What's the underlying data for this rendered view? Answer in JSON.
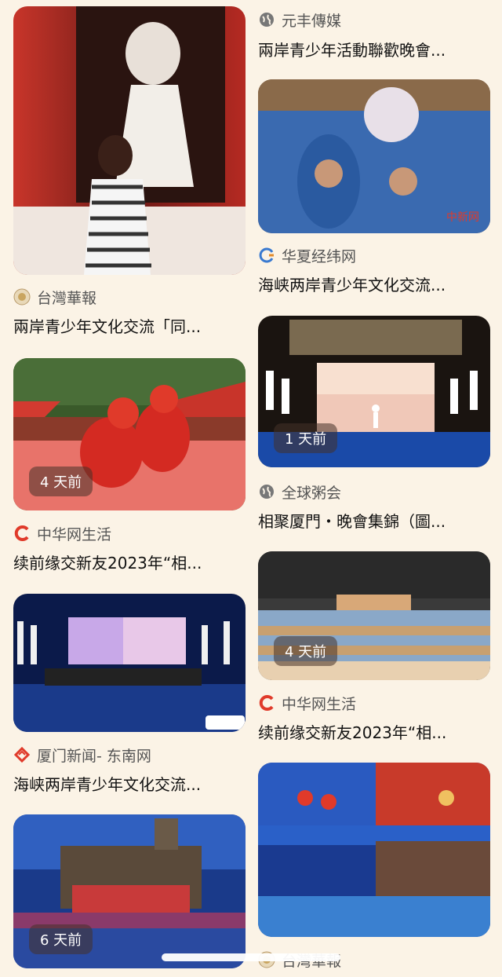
{
  "left": [
    {
      "source": "台灣華報",
      "title": "兩岸青少年文化交流「同...",
      "badge": ""
    },
    {
      "source": "中华网生活",
      "title": "续前缘交新友2023年“相...",
      "badge": "4 天前"
    },
    {
      "source": "厦门新闻- 东南网",
      "title": "海峡两岸青少年文化交流...",
      "badge": ""
    },
    {
      "source": "",
      "title": "",
      "badge": "6 天前"
    }
  ],
  "right": [
    {
      "source": "元丰傳媒",
      "title": "兩岸青少年活動聯歡晚會...",
      "badge": ""
    },
    {
      "source": "华夏经纬网",
      "title": "海峡两岸青少年文化交流...",
      "badge": ""
    },
    {
      "source": "全球粥会",
      "title": "相聚厦門・晚會集錦（圖...",
      "badge": "1 天前"
    },
    {
      "source": "中华网生活",
      "title": "续前缘交新友2023年“相...",
      "badge": "4 天前"
    },
    {
      "source": "台灣華報",
      "title": "",
      "badge": ""
    }
  ],
  "colors": {
    "background": "#fbf3e6",
    "accent_red": "#e03a2a"
  }
}
